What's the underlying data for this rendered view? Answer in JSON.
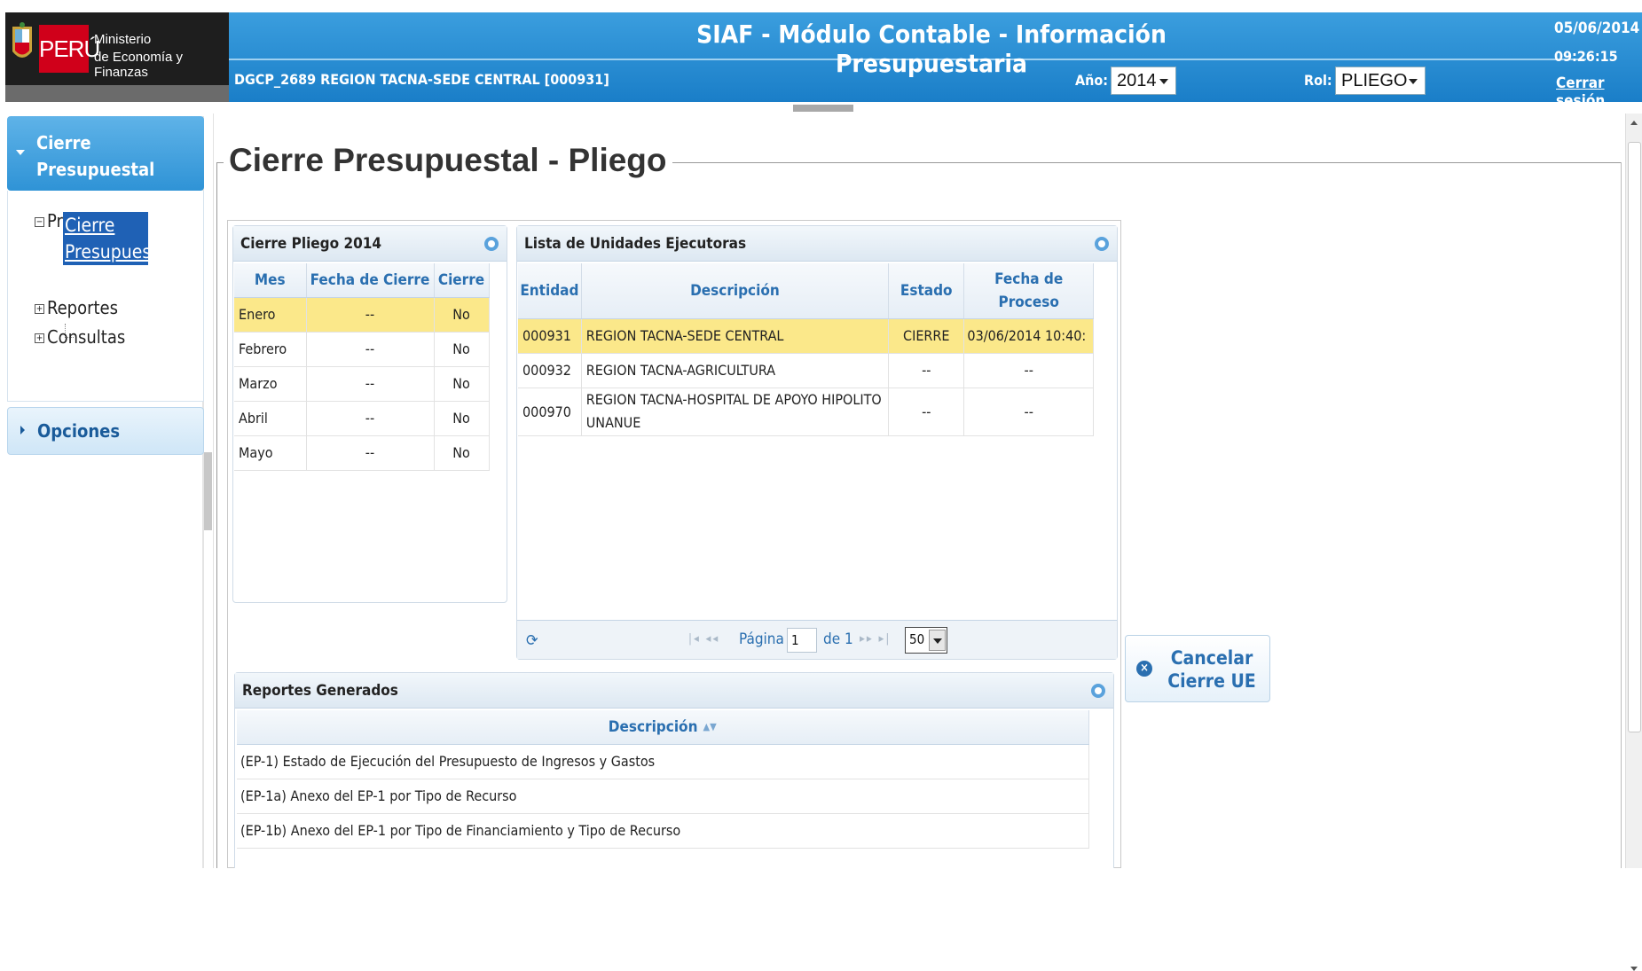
{
  "header": {
    "logo_country": "PERÚ",
    "logo_line1": "Ministerio",
    "logo_line2": "de Economía y Finanzas",
    "app_title": "SIAF - Módulo Contable - Información Presupuestaria",
    "entity": "DGCP_2689  REGION TACNA-SEDE CENTRAL  [000931]",
    "year_label": "Año:",
    "year_value": "2014",
    "rol_label": "Rol:",
    "rol_value": "PLIEGO",
    "date": "05/06/2014",
    "time": "09:26:15",
    "logout": "Cerrar sesión"
  },
  "sidebar": {
    "section_active": "Cierre Presupuestal",
    "tree": {
      "procesos": "Procesos",
      "procesos_child": "Cierre Presupuestal",
      "reportes": "Reportes",
      "consultas": "Consultas"
    },
    "section_opciones": "Opciones"
  },
  "main": {
    "page_title": "Cierre Presupuestal - Pliego",
    "cierre_grid": {
      "caption": "Cierre Pliego 2014",
      "columns": [
        "Mes",
        "Fecha de Cierre",
        "Cierre"
      ],
      "rows": [
        {
          "mes": "Enero",
          "fecha": "--",
          "cierre": "No"
        },
        {
          "mes": "Febrero",
          "fecha": "--",
          "cierre": "No"
        },
        {
          "mes": "Marzo",
          "fecha": "--",
          "cierre": "No"
        },
        {
          "mes": "Abril",
          "fecha": "--",
          "cierre": "No"
        },
        {
          "mes": "Mayo",
          "fecha": "--",
          "cierre": "No"
        }
      ]
    },
    "ue_grid": {
      "caption": "Lista de Unidades Ejecutoras",
      "columns": [
        "Entidad",
        "Descripción",
        "Estado",
        "Fecha de Proceso"
      ],
      "rows": [
        {
          "entidad": "000931",
          "descripcion": "REGION TACNA-SEDE CENTRAL",
          "estado": "CIERRE",
          "fecha": "03/06/2014 10:40:"
        },
        {
          "entidad": "000932",
          "descripcion": "REGION TACNA-AGRICULTURA",
          "estado": "--",
          "fecha": "--"
        },
        {
          "entidad": "000970",
          "descripcion": "REGION TACNA-HOSPITAL DE APOYO HIPOLITO UNANUE",
          "estado": "--",
          "fecha": "--"
        }
      ],
      "pager": {
        "page_label": "Página",
        "page_value": "1",
        "of_label": "de 1",
        "page_size": "50"
      }
    },
    "cancel_button": "Cancelar Cierre UE",
    "reportes_grid": {
      "caption": "Reportes Generados",
      "column": "Descripción",
      "rows": [
        "(EP-1) Estado de Ejecución del Presupuesto de Ingresos y Gastos",
        "(EP-1a) Anexo del EP-1 por Tipo de Recurso",
        "(EP-1b) Anexo del EP-1 por Tipo de Financiamiento y Tipo de Recurso"
      ]
    }
  },
  "colors": {
    "header_blue": "#1a7ec8",
    "selected_row": "#fbe88a",
    "link_blue": "#2a6fb0",
    "logo_red": "#d0001a"
  },
  "icons": {
    "collapse": "circle-collapse-icon",
    "refresh": "refresh-icon",
    "cancel": "cancel-circle-icon"
  }
}
